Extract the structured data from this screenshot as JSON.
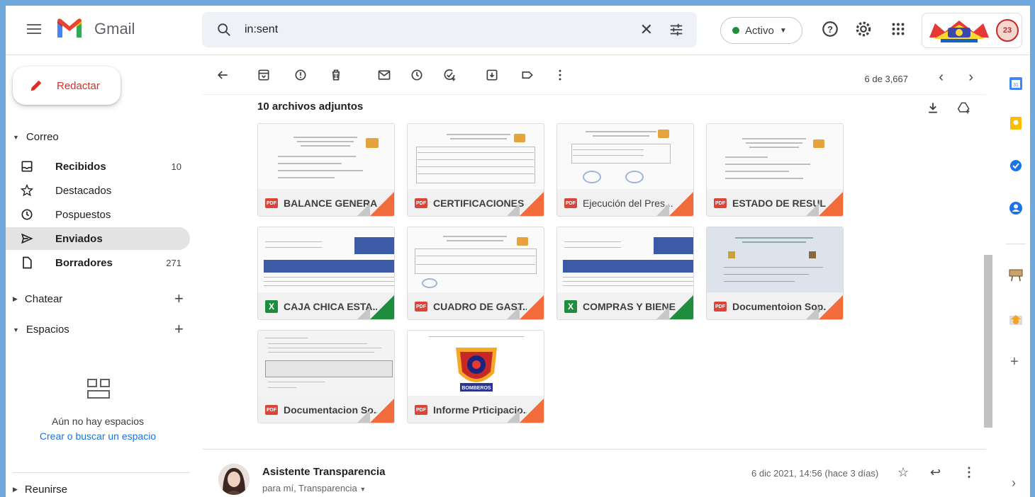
{
  "app": {
    "name": "Gmail"
  },
  "search": {
    "value": "in:sent",
    "clear_icon": "close-icon",
    "options_icon": "tune-icon"
  },
  "status": {
    "label": "Activo",
    "color": "#1e8e3e"
  },
  "header_icons": [
    "help-icon",
    "settings-icon",
    "apps-icon"
  ],
  "account": {
    "badge": "23"
  },
  "compose": {
    "label": "Redactar"
  },
  "sidebar": {
    "mail_section": "Correo",
    "items": [
      {
        "label": "Recibidos",
        "count": "10",
        "icon": "inbox-icon",
        "bold": true
      },
      {
        "label": "Destacados",
        "count": "",
        "icon": "star-icon",
        "bold": false
      },
      {
        "label": "Pospuestos",
        "count": "",
        "icon": "clock-icon",
        "bold": false
      },
      {
        "label": "Enviados",
        "count": "",
        "icon": "send-icon",
        "bold": true,
        "active": true
      },
      {
        "label": "Borradores",
        "count": "271",
        "icon": "draft-icon",
        "bold": true
      }
    ],
    "chat_section": "Chatear",
    "spaces_section": "Espacios",
    "spaces_empty": "Aún no hay espacios",
    "spaces_link": "Crear o buscar un espacio",
    "meet_section": "Reunirse"
  },
  "toolbar": {
    "pager": "6 de 3,667"
  },
  "attachments": {
    "title": "10 archivos adjuntos",
    "files": [
      {
        "name": "BALANCE GENERA...",
        "type": "PDF"
      },
      {
        "name": "CERTIFICACIONES ...",
        "type": "PDF"
      },
      {
        "name": "Ejecución del Pres...",
        "type": "PDF"
      },
      {
        "name": "ESTADO DE RESUL...",
        "type": "PDF"
      },
      {
        "name": "CAJA CHICA ESTA...",
        "type": "XLS"
      },
      {
        "name": "CUADRO DE GAST...",
        "type": "PDF"
      },
      {
        "name": "COMPRAS Y BIENE...",
        "type": "XLS"
      },
      {
        "name": "Documentoion Sop...",
        "type": "PDF"
      },
      {
        "name": "Documentacion So...",
        "type": "PDF"
      },
      {
        "name": "Informe Prticipacio...",
        "type": "PDF"
      }
    ],
    "thumb_text": "BOMBEROS"
  },
  "message": {
    "sender": "Asistente Transparencia",
    "to": "para mí, Transparencia",
    "date": "6 dic 2021, 14:56 (hace 3 días)"
  },
  "colors": {
    "pdf": "#db4437",
    "xls": "#1e8e3e",
    "accent": "#d93025",
    "active_nav": "#e3e3e3"
  }
}
